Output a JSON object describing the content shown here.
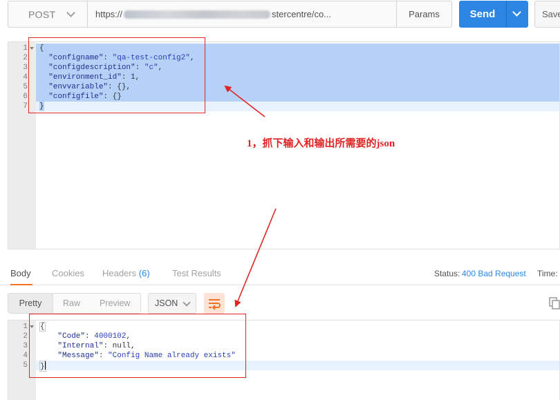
{
  "request": {
    "method": "POST",
    "url_prefix": "https://",
    "url_suffix": "stercentre/co...",
    "params_label": "Params",
    "send_label": "Send",
    "save_label": "Save"
  },
  "request_body": {
    "line_numbers": [
      "1",
      "2",
      "3",
      "4",
      "5",
      "6",
      "7"
    ],
    "lines": {
      "l1": "{",
      "l2_key": "\"configname\"",
      "l2_val": "\"qa-test-config2\"",
      "l3_key": "\"configdescription\"",
      "l3_val": "\"c\"",
      "l4_key": "\"environment_id\"",
      "l4_val": "1",
      "l5_key": "\"envvariable\"",
      "l5_val": "{}",
      "l6_key": "\"configfile\"",
      "l6_val": "{}",
      "l7": "}"
    }
  },
  "annotation": {
    "note": "1，抓下输入和输出所需要的json",
    "color": "#e02424"
  },
  "response_tabs": {
    "body": "Body",
    "cookies": "Cookies",
    "headers": "Headers",
    "headers_count": "(6)",
    "test_results": "Test Results",
    "status_label": "Status:",
    "status_value": "400 Bad Request",
    "time_label": "Time:"
  },
  "view_modes": {
    "pretty": "Pretty",
    "raw": "Raw",
    "preview": "Preview",
    "format": "JSON"
  },
  "response_body": {
    "line_numbers": [
      "1",
      "2",
      "3",
      "4",
      "5"
    ],
    "lines": {
      "l1": "{",
      "l2_key": "\"Code\"",
      "l2_val": "4000102",
      "l3_key": "\"Internal\"",
      "l3_val": "null",
      "l4_key": "\"Message\"",
      "l4_val": "\"Config Name already exists\"",
      "l5": "}"
    }
  },
  "colors": {
    "accent": "#2d86e2",
    "tab_underline": "#f47023",
    "selection": "#b5d1f7"
  }
}
